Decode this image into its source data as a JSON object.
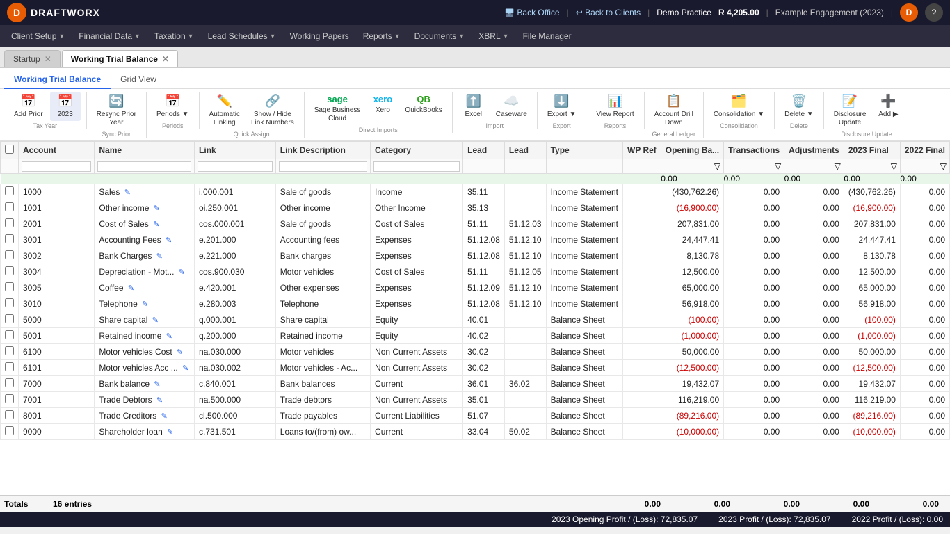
{
  "topnav": {
    "logo": "D",
    "logoText": "DRAFTWORX",
    "backOffice": "Back Office",
    "backToClients": "Back to Clients",
    "practice": "Demo Practice",
    "amount": "R 4,205.00",
    "engagement": "Example Engagement (2023)",
    "avatar": "D",
    "help": "?"
  },
  "menubar": {
    "items": [
      {
        "label": "Client Setup",
        "caret": true
      },
      {
        "label": "Financial Data",
        "caret": true
      },
      {
        "label": "Taxation",
        "caret": true
      },
      {
        "label": "Lead Schedules",
        "caret": true
      },
      {
        "label": "Working Papers",
        "caret": false
      },
      {
        "label": "Reports",
        "caret": true
      },
      {
        "label": "Documents",
        "caret": true
      },
      {
        "label": "XBRL",
        "caret": true
      },
      {
        "label": "File Manager",
        "caret": false
      }
    ]
  },
  "tabs": [
    {
      "label": "Startup",
      "closable": true,
      "active": false
    },
    {
      "label": "Working Trial Balance",
      "closable": true,
      "active": true
    }
  ],
  "subtabs": [
    {
      "label": "Working Trial Balance",
      "active": true
    },
    {
      "label": "Grid View",
      "active": false
    }
  ],
  "toolbar": {
    "groups": [
      {
        "label": "Tax Year",
        "items": [
          {
            "icon": "📅",
            "label": "Add Prior",
            "active": false
          },
          {
            "icon": "📅",
            "label": "2023",
            "active": true
          }
        ]
      },
      {
        "label": "Sync Prior",
        "items": [
          {
            "icon": "🔄",
            "label": "Resync Prior Year",
            "active": false
          }
        ]
      },
      {
        "label": "Periods",
        "items": [
          {
            "icon": "📅",
            "label": "Periods",
            "active": false,
            "caret": true
          }
        ]
      },
      {
        "label": "Quick Assign",
        "items": [
          {
            "icon": "✏️",
            "label": "Automatic Linking",
            "active": false
          },
          {
            "icon": "🔗",
            "label": "Show / Hide Link Numbers",
            "active": false
          }
        ]
      },
      {
        "label": "Direct Imports",
        "items": [
          {
            "icon": "SAGE",
            "label": "Sage Business Cloud",
            "active": false,
            "type": "logo"
          },
          {
            "icon": "XERO",
            "label": "Xero",
            "active": false,
            "type": "logo"
          },
          {
            "icon": "QB",
            "label": "QuickBooks",
            "active": false,
            "type": "logo"
          }
        ]
      },
      {
        "label": "Import",
        "items": [
          {
            "icon": "⬆️",
            "label": "Excel",
            "active": false
          },
          {
            "icon": "☁️",
            "label": "Caseware",
            "active": false
          }
        ]
      },
      {
        "label": "Export",
        "items": [
          {
            "icon": "⬇️",
            "label": "Export",
            "active": false,
            "caret": true
          }
        ]
      },
      {
        "label": "Reports",
        "items": [
          {
            "icon": "📊",
            "label": "View Report",
            "active": false
          }
        ]
      },
      {
        "label": "General Ledger",
        "items": [
          {
            "icon": "📋",
            "label": "Account Drill Down",
            "active": false
          }
        ]
      },
      {
        "label": "Consolidation",
        "items": [
          {
            "icon": "🗂️",
            "label": "Consolidation",
            "active": false,
            "caret": true
          }
        ]
      },
      {
        "label": "Delete",
        "items": [
          {
            "icon": "🗑️",
            "label": "Delete",
            "active": false,
            "caret": true
          }
        ]
      },
      {
        "label": "Disclosure Update",
        "items": [
          {
            "icon": "📝",
            "label": "Disclosure Update",
            "active": false
          },
          {
            "icon": "➕",
            "label": "Add",
            "active": false
          }
        ]
      }
    ]
  },
  "table": {
    "columns": [
      "",
      "Account",
      "Name",
      "Link",
      "Link Description",
      "Category",
      "Lead",
      "Lead",
      "Type",
      "WP Ref",
      "Opening Ba...",
      "Transactions",
      "Adjustments",
      "2023 Final",
      "2022 Final"
    ],
    "greenRow": [
      "",
      "",
      "",
      "",
      "",
      "",
      "",
      "",
      "",
      "",
      "0.00",
      "0.00",
      "0.00",
      "0.00",
      "0.00"
    ],
    "rows": [
      {
        "cb": false,
        "account": "1000",
        "name": "Sales",
        "link": "i.000.001",
        "linkDesc": "Sale of goods",
        "category": "Income",
        "lead1": "35.11",
        "lead2": "",
        "type": "Income Statement",
        "wpRef": "",
        "openBal": "(430,762.26)",
        "trans": "0.00",
        "adj": "0.00",
        "final2023": "(430,762.26)",
        "final2022": "0.00",
        "nameIcon": true
      },
      {
        "cb": false,
        "account": "1001",
        "name": "Other income",
        "link": "oi.250.001",
        "linkDesc": "Other income",
        "category": "Other Income",
        "lead1": "35.13",
        "lead2": "",
        "type": "Income Statement",
        "wpRef": "",
        "openBal": "(16,900.00)",
        "trans": "0.00",
        "adj": "0.00",
        "final2023": "(16,900.00)",
        "final2022": "0.00",
        "nameIcon": true,
        "red": true
      },
      {
        "cb": false,
        "account": "2001",
        "name": "Cost of Sales",
        "link": "cos.000.001",
        "linkDesc": "Sale of goods",
        "category": "Cost of Sales",
        "lead1": "51.11",
        "lead2": "51.12.03",
        "type": "Income Statement",
        "wpRef": "",
        "openBal": "207,831.00",
        "trans": "0.00",
        "adj": "0.00",
        "final2023": "207,831.00",
        "final2022": "0.00",
        "nameIcon": true
      },
      {
        "cb": false,
        "account": "3001",
        "name": "Accounting Fees",
        "link": "e.201.000",
        "linkDesc": "Accounting fees",
        "category": "Expenses",
        "lead1": "51.12.08",
        "lead2": "51.12.10",
        "type": "Income Statement",
        "wpRef": "",
        "openBal": "24,447.41",
        "trans": "0.00",
        "adj": "0.00",
        "final2023": "24,447.41",
        "final2022": "0.00",
        "nameIcon": true
      },
      {
        "cb": false,
        "account": "3002",
        "name": "Bank Charges",
        "link": "e.221.000",
        "linkDesc": "Bank charges",
        "category": "Expenses",
        "lead1": "51.12.08",
        "lead2": "51.12.10",
        "type": "Income Statement",
        "wpRef": "",
        "openBal": "8,130.78",
        "trans": "0.00",
        "adj": "0.00",
        "final2023": "8,130.78",
        "final2022": "0.00",
        "nameIcon": true
      },
      {
        "cb": false,
        "account": "3004",
        "name": "Depreciation - Mot...",
        "link": "cos.900.030",
        "linkDesc": "Motor vehicles",
        "category": "Cost of Sales",
        "lead1": "51.11",
        "lead2": "51.12.05",
        "type": "Income Statement",
        "wpRef": "",
        "openBal": "12,500.00",
        "trans": "0.00",
        "adj": "0.00",
        "final2023": "12,500.00",
        "final2022": "0.00",
        "nameIcon": true
      },
      {
        "cb": false,
        "account": "3005",
        "name": "Coffee",
        "link": "e.420.001",
        "linkDesc": "Other expenses",
        "category": "Expenses",
        "lead1": "51.12.09",
        "lead2": "51.12.10",
        "type": "Income Statement",
        "wpRef": "",
        "openBal": "65,000.00",
        "trans": "0.00",
        "adj": "0.00",
        "final2023": "65,000.00",
        "final2022": "0.00",
        "nameIcon": true
      },
      {
        "cb": false,
        "account": "3010",
        "name": "Telephone",
        "link": "e.280.003",
        "linkDesc": "Telephone",
        "category": "Expenses",
        "lead1": "51.12.08",
        "lead2": "51.12.10",
        "type": "Income Statement",
        "wpRef": "",
        "openBal": "56,918.00",
        "trans": "0.00",
        "adj": "0.00",
        "final2023": "56,918.00",
        "final2022": "0.00",
        "nameIcon": true
      },
      {
        "cb": false,
        "account": "5000",
        "name": "Share capital",
        "link": "q.000.001",
        "linkDesc": "Share capital",
        "category": "Equity",
        "lead1": "40.01",
        "lead2": "",
        "type": "Balance Sheet",
        "wpRef": "",
        "openBal": "(100.00)",
        "trans": "0.00",
        "adj": "0.00",
        "final2023": "(100.00)",
        "final2022": "0.00",
        "nameIcon": true,
        "red": true
      },
      {
        "cb": false,
        "account": "5001",
        "name": "Retained income",
        "link": "q.200.000",
        "linkDesc": "Retained income",
        "category": "Equity",
        "lead1": "40.02",
        "lead2": "",
        "type": "Balance Sheet",
        "wpRef": "",
        "openBal": "(1,000.00)",
        "trans": "0.00",
        "adj": "0.00",
        "final2023": "(1,000.00)",
        "final2022": "0.00",
        "nameIcon": true,
        "red": true
      },
      {
        "cb": false,
        "account": "6100",
        "name": "Motor vehicles Cost",
        "link": "na.030.000",
        "linkDesc": "Motor vehicles",
        "category": "Non Current Assets",
        "lead1": "30.02",
        "lead2": "",
        "type": "Balance Sheet",
        "wpRef": "",
        "openBal": "50,000.00",
        "trans": "0.00",
        "adj": "0.00",
        "final2023": "50,000.00",
        "final2022": "0.00",
        "nameIcon": true
      },
      {
        "cb": false,
        "account": "6101",
        "name": "Motor vehicles Acc ...",
        "link": "na.030.002",
        "linkDesc": "Motor vehicles - Ac...",
        "category": "Non Current Assets",
        "lead1": "30.02",
        "lead2": "",
        "type": "Balance Sheet",
        "wpRef": "",
        "openBal": "(12,500.00)",
        "trans": "0.00",
        "adj": "0.00",
        "final2023": "(12,500.00)",
        "final2022": "0.00",
        "nameIcon": true,
        "red": true
      },
      {
        "cb": false,
        "account": "7000",
        "name": "Bank balance",
        "link": "c.840.001",
        "linkDesc": "Bank balances",
        "category": "Current",
        "lead1": "36.01",
        "lead2": "36.02",
        "type": "Balance Sheet",
        "wpRef": "",
        "openBal": "19,432.07",
        "trans": "0.00",
        "adj": "0.00",
        "final2023": "19,432.07",
        "final2022": "0.00",
        "nameIcon": true
      },
      {
        "cb": false,
        "account": "7001",
        "name": "Trade Debtors",
        "link": "na.500.000",
        "linkDesc": "Trade debtors",
        "category": "Non Current Assets",
        "lead1": "35.01",
        "lead2": "",
        "type": "Balance Sheet",
        "wpRef": "",
        "openBal": "116,219.00",
        "trans": "0.00",
        "adj": "0.00",
        "final2023": "116,219.00",
        "final2022": "0.00",
        "nameIcon": true
      },
      {
        "cb": false,
        "account": "8001",
        "name": "Trade Creditors",
        "link": "cl.500.000",
        "linkDesc": "Trade payables",
        "category": "Current Liabilities",
        "lead1": "51.07",
        "lead2": "",
        "type": "Balance Sheet",
        "wpRef": "",
        "openBal": "(89,216.00)",
        "trans": "0.00",
        "adj": "0.00",
        "final2023": "(89,216.00)",
        "final2022": "0.00",
        "nameIcon": true,
        "red": true
      },
      {
        "cb": false,
        "account": "9000",
        "name": "Shareholder loan",
        "link": "c.731.501",
        "linkDesc": "Loans to/(from) ow...",
        "category": "Current",
        "lead1": "33.04",
        "lead2": "50.02",
        "type": "Balance Sheet",
        "wpRef": "",
        "openBal": "(10,000.00)",
        "trans": "0.00",
        "adj": "0.00",
        "final2023": "(10,000.00)",
        "final2022": "0.00",
        "nameIcon": true,
        "red": true
      }
    ]
  },
  "footer": {
    "totals_label": "Totals",
    "entries": "16 entries",
    "openBal": "0.00",
    "trans": "0.00",
    "adj": "0.00",
    "final2023": "0.00",
    "final2022": "0.00"
  },
  "statusBar": {
    "openingProfit": "2023 Opening Profit / (Loss): 72,835.07",
    "profit2023": "2023 Profit / (Loss): 72,835.07",
    "profit2022": "2022 Profit / (Loss): 0.00"
  }
}
